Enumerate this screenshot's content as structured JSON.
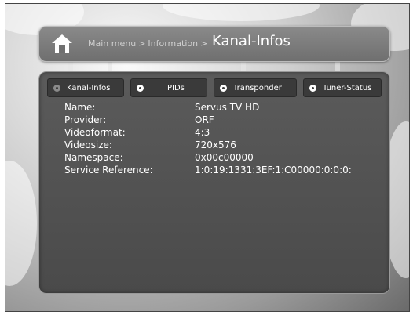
{
  "header": {
    "breadcrumb": [
      "Main menu",
      "Information"
    ],
    "separator": ">",
    "title": "Kanal-Infos"
  },
  "tabs": [
    {
      "label": "Kanal-Infos",
      "dot": "grey"
    },
    {
      "label": "PIDs",
      "dot": "white"
    },
    {
      "label": "Transponder",
      "dot": "white"
    },
    {
      "label": "Tuner-Status",
      "dot": "white"
    }
  ],
  "info": [
    {
      "label": "Name:",
      "value": "Servus TV HD"
    },
    {
      "label": "Provider:",
      "value": "ORF"
    },
    {
      "label": "Videoformat:",
      "value": "4:3"
    },
    {
      "label": "Videosize:",
      "value": "720x576"
    },
    {
      "label": "Namespace:",
      "value": "0x00c00000"
    },
    {
      "label": "Service Reference:",
      "value": "1:0:19:1331:3EF:1:C00000:0:0:0:"
    }
  ],
  "icons": {
    "home": "home-icon",
    "tab_indicator": "radio-dot-icon"
  }
}
